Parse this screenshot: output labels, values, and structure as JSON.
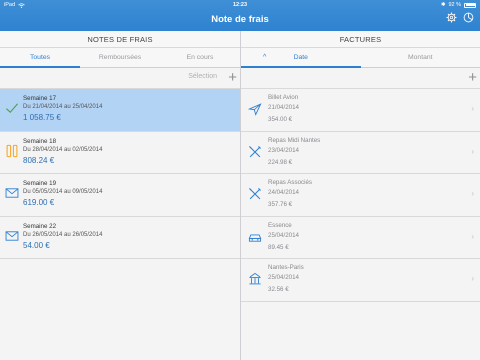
{
  "status": {
    "carrier": "iPad",
    "time": "12:23",
    "battery": "92 %"
  },
  "header": {
    "title": "Note de frais"
  },
  "left": {
    "section_title": "NOTES DE FRAIS",
    "tabs": [
      {
        "label": "Toutes"
      },
      {
        "label": "Remboursées"
      },
      {
        "label": "En cours"
      }
    ],
    "selection_label": "Sélection",
    "add_label": "+",
    "notes": [
      {
        "week": "Semaine 17",
        "range": "Du 21/04/2014 au 25/04/2014",
        "amount": "1 058.75 €",
        "icon": "check-icon"
      },
      {
        "week": "Semaine 18",
        "range": "Du 28/04/2014 au 02/05/2014",
        "amount": "808.24 €",
        "icon": "pause-icon"
      },
      {
        "week": "Semaine 19",
        "range": "Du 05/05/2014 au 09/05/2014",
        "amount": "619.00 €",
        "icon": "envelope-icon"
      },
      {
        "week": "Semaine 22",
        "range": "Du 26/05/2014 au 26/05/2014",
        "amount": "54.00 €",
        "icon": "envelope-icon"
      }
    ]
  },
  "right": {
    "section_title": "FACTURES",
    "tabs": [
      {
        "label": "Date"
      },
      {
        "label": "Montant"
      }
    ],
    "sort_indicator": "^",
    "add_label": "+",
    "factures": [
      {
        "name": "Billet Avion",
        "date": "21/04/2014",
        "amount": "354.00 €",
        "icon": "plane-icon"
      },
      {
        "name": "Repas Midi Nantes",
        "date": "23/04/2014",
        "amount": "224.98 €",
        "icon": "cutlery-icon"
      },
      {
        "name": "Repas Associés",
        "date": "24/04/2014",
        "amount": "357.76 €",
        "icon": "cutlery-icon"
      },
      {
        "name": "Essence",
        "date": "25/04/2014",
        "amount": "89.45 €",
        "icon": "car-icon"
      },
      {
        "name": "Nantes-Paris",
        "date": "25/04/2014",
        "amount": "32.56 €",
        "icon": "toll-icon"
      }
    ]
  },
  "colors": {
    "accent": "#2f80d0",
    "selected_row": "#b3d3f5",
    "pause": "#f5a623"
  }
}
